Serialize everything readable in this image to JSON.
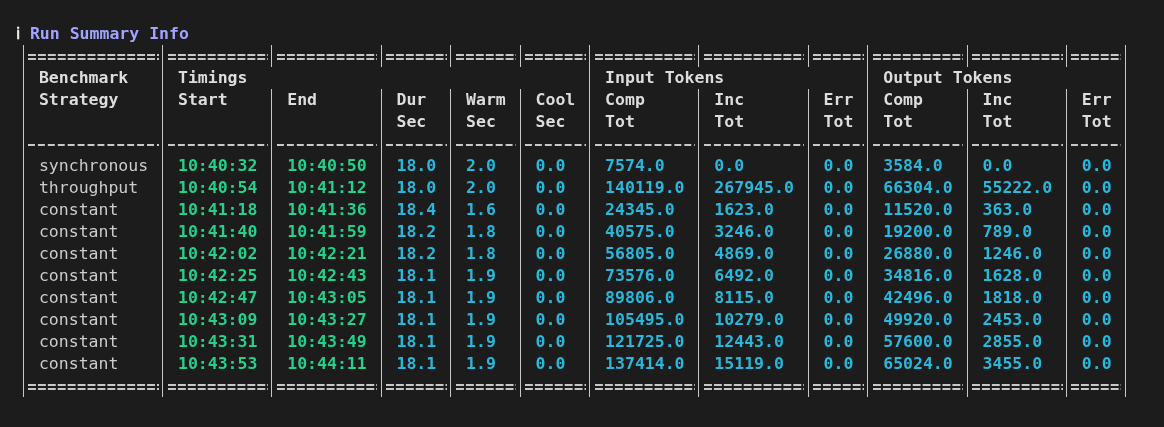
{
  "icon": "ℹ",
  "title": "Run Summary Info",
  "table": {
    "first_column": {
      "kind": "text",
      "lines": [
        "Benchmark",
        "Strategy"
      ]
    },
    "groups": [
      {
        "label": "Timings",
        "columns": [
          {
            "kind": "time",
            "lines": [
              "Start"
            ]
          },
          {
            "kind": "time",
            "lines": [
              "End"
            ]
          },
          {
            "kind": "number",
            "lines": [
              "Dur",
              "Sec"
            ]
          },
          {
            "kind": "number",
            "lines": [
              "Warm",
              "Sec"
            ]
          },
          {
            "kind": "number",
            "lines": [
              "Cool",
              "Sec"
            ]
          }
        ]
      },
      {
        "label": "Input Tokens",
        "columns": [
          {
            "kind": "number",
            "lines": [
              "Comp",
              "Tot"
            ]
          },
          {
            "kind": "number",
            "lines": [
              "Inc",
              "Tot"
            ]
          },
          {
            "kind": "number",
            "lines": [
              "Err",
              "Tot"
            ]
          }
        ]
      },
      {
        "label": "Output Tokens",
        "columns": [
          {
            "kind": "number",
            "lines": [
              "Comp",
              "Tot"
            ]
          },
          {
            "kind": "number",
            "lines": [
              "Inc",
              "Tot"
            ]
          },
          {
            "kind": "number",
            "lines": [
              "Err",
              "Tot"
            ]
          }
        ]
      }
    ],
    "rows": [
      [
        "synchronous",
        "10:40:32",
        "10:40:50",
        "18.0",
        "2.0",
        "0.0",
        "7574.0",
        "0.0",
        "0.0",
        "3584.0",
        "0.0",
        "0.0"
      ],
      [
        "throughput",
        "10:40:54",
        "10:41:12",
        "18.0",
        "2.0",
        "0.0",
        "140119.0",
        "267945.0",
        "0.0",
        "66304.0",
        "55222.0",
        "0.0"
      ],
      [
        "constant",
        "10:41:18",
        "10:41:36",
        "18.4",
        "1.6",
        "0.0",
        "24345.0",
        "1623.0",
        "0.0",
        "11520.0",
        "363.0",
        "0.0"
      ],
      [
        "constant",
        "10:41:40",
        "10:41:59",
        "18.2",
        "1.8",
        "0.0",
        "40575.0",
        "3246.0",
        "0.0",
        "19200.0",
        "789.0",
        "0.0"
      ],
      [
        "constant",
        "10:42:02",
        "10:42:21",
        "18.2",
        "1.8",
        "0.0",
        "56805.0",
        "4869.0",
        "0.0",
        "26880.0",
        "1246.0",
        "0.0"
      ],
      [
        "constant",
        "10:42:25",
        "10:42:43",
        "18.1",
        "1.9",
        "0.0",
        "73576.0",
        "6492.0",
        "0.0",
        "34816.0",
        "1628.0",
        "0.0"
      ],
      [
        "constant",
        "10:42:47",
        "10:43:05",
        "18.1",
        "1.9",
        "0.0",
        "89806.0",
        "8115.0",
        "0.0",
        "42496.0",
        "1818.0",
        "0.0"
      ],
      [
        "constant",
        "10:43:09",
        "10:43:27",
        "18.1",
        "1.9",
        "0.0",
        "105495.0",
        "10279.0",
        "0.0",
        "49920.0",
        "2453.0",
        "0.0"
      ],
      [
        "constant",
        "10:43:31",
        "10:43:49",
        "18.1",
        "1.9",
        "0.0",
        "121725.0",
        "12443.0",
        "0.0",
        "57600.0",
        "2855.0",
        "0.0"
      ],
      [
        "constant",
        "10:43:53",
        "10:44:11",
        "18.1",
        "1.9",
        "0.0",
        "137414.0",
        "15119.0",
        "0.0",
        "65024.0",
        "3455.0",
        "0.0"
      ]
    ]
  }
}
